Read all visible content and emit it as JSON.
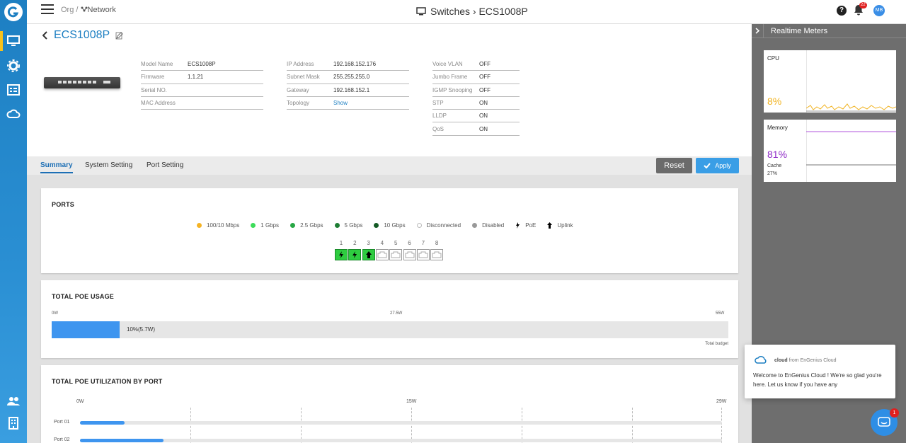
{
  "topbar": {
    "crumb_org": "Org /",
    "crumb_network": "Network",
    "title": "Switches › ECS1008P",
    "notification_count": "22",
    "user_initials": "MB"
  },
  "device": {
    "name": "ECS1008P",
    "col1": [
      {
        "k": "Model Name",
        "v": "ECS1008P"
      },
      {
        "k": "Firmware",
        "v": "1.1.21"
      },
      {
        "k": "Serial NO.",
        "v": ""
      },
      {
        "k": "MAC Address",
        "v": ""
      }
    ],
    "col2": [
      {
        "k": "IP Address",
        "v": "192.168.152.176"
      },
      {
        "k": "Subnet Mask",
        "v": "255.255.255.0"
      },
      {
        "k": "Gateway",
        "v": "192.168.152.1"
      },
      {
        "k": "Topology",
        "v": "Show"
      }
    ],
    "col3": [
      {
        "k": "Voice VLAN",
        "v": "OFF"
      },
      {
        "k": "Jumbo Frame",
        "v": "OFF"
      },
      {
        "k": "IGMP Snooping",
        "v": "OFF"
      },
      {
        "k": "STP",
        "v": "ON"
      },
      {
        "k": "LLDP",
        "v": "ON"
      },
      {
        "k": "QoS",
        "v": "ON"
      }
    ]
  },
  "tabs": [
    "Summary",
    "System Setting",
    "Port Setting"
  ],
  "buttons": {
    "reset": "Reset",
    "apply": "Apply"
  },
  "ports_card": {
    "title": "PORTS",
    "legend": [
      {
        "label": "100/10 Mbps",
        "color": "#f5b324"
      },
      {
        "label": "1 Gbps",
        "color": "#3ddc5a"
      },
      {
        "label": "2.5 Gbps",
        "color": "#28a745"
      },
      {
        "label": "5 Gbps",
        "color": "#1e7e34"
      },
      {
        "label": "10 Gbps",
        "color": "#145a25"
      },
      {
        "label": "Disconnected",
        "color": "#ffffff"
      },
      {
        "label": "Disabled",
        "color": "#999999"
      },
      {
        "label": "PoE",
        "color": "#000000"
      },
      {
        "label": "Uplink",
        "color": "#000000"
      }
    ],
    "ports": [
      {
        "num": "1",
        "state": "poe"
      },
      {
        "num": "2",
        "state": "poe"
      },
      {
        "num": "3",
        "state": "uplink"
      },
      {
        "num": "4",
        "state": "off"
      },
      {
        "num": "5",
        "state": "off"
      },
      {
        "num": "6",
        "state": "off"
      },
      {
        "num": "7",
        "state": "off"
      },
      {
        "num": "8",
        "state": "off"
      }
    ]
  },
  "poe_usage": {
    "title": "TOTAL POE USAGE",
    "scale_min": "0W",
    "scale_mid": "27.5W",
    "scale_max": "55W",
    "fraction": 0.1,
    "value_label": "10%(5.7W)",
    "budget_label": "Total budget"
  },
  "poe_by_port": {
    "title": "TOTAL POE UTILIZATION BY PORT",
    "scale_min": "0W",
    "scale_mid": "15W",
    "scale_max": "29W",
    "rows": [
      {
        "label": "Port 01",
        "fraction": 0.07
      },
      {
        "label": "Port 02",
        "fraction": 0.13
      }
    ]
  },
  "realtime": {
    "title": "Realtime Meters",
    "cpu_label": "CPU",
    "cpu_value": "8%",
    "memory_label": "Memory",
    "memory_value": "81%",
    "cache_label": "Cache",
    "cache_value": "27%"
  },
  "chat": {
    "from_bold": "cloud",
    "from_rest": "from EnGenius Cloud",
    "message": "Welcome to EnGenius Cloud ! We're so glad you're here. Let us know if you have any",
    "badge": "1"
  }
}
